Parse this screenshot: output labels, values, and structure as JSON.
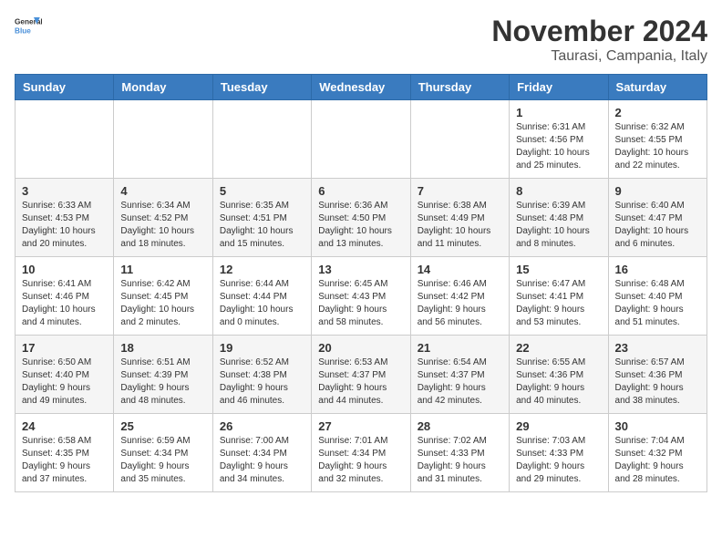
{
  "header": {
    "logo_general": "General",
    "logo_blue": "Blue",
    "title": "November 2024",
    "location": "Taurasi, Campania, Italy"
  },
  "weekdays": [
    "Sunday",
    "Monday",
    "Tuesday",
    "Wednesday",
    "Thursday",
    "Friday",
    "Saturday"
  ],
  "weeks": [
    [
      {
        "day": "",
        "info": ""
      },
      {
        "day": "",
        "info": ""
      },
      {
        "day": "",
        "info": ""
      },
      {
        "day": "",
        "info": ""
      },
      {
        "day": "",
        "info": ""
      },
      {
        "day": "1",
        "info": "Sunrise: 6:31 AM\nSunset: 4:56 PM\nDaylight: 10 hours and 25 minutes."
      },
      {
        "day": "2",
        "info": "Sunrise: 6:32 AM\nSunset: 4:55 PM\nDaylight: 10 hours and 22 minutes."
      }
    ],
    [
      {
        "day": "3",
        "info": "Sunrise: 6:33 AM\nSunset: 4:53 PM\nDaylight: 10 hours and 20 minutes."
      },
      {
        "day": "4",
        "info": "Sunrise: 6:34 AM\nSunset: 4:52 PM\nDaylight: 10 hours and 18 minutes."
      },
      {
        "day": "5",
        "info": "Sunrise: 6:35 AM\nSunset: 4:51 PM\nDaylight: 10 hours and 15 minutes."
      },
      {
        "day": "6",
        "info": "Sunrise: 6:36 AM\nSunset: 4:50 PM\nDaylight: 10 hours and 13 minutes."
      },
      {
        "day": "7",
        "info": "Sunrise: 6:38 AM\nSunset: 4:49 PM\nDaylight: 10 hours and 11 minutes."
      },
      {
        "day": "8",
        "info": "Sunrise: 6:39 AM\nSunset: 4:48 PM\nDaylight: 10 hours and 8 minutes."
      },
      {
        "day": "9",
        "info": "Sunrise: 6:40 AM\nSunset: 4:47 PM\nDaylight: 10 hours and 6 minutes."
      }
    ],
    [
      {
        "day": "10",
        "info": "Sunrise: 6:41 AM\nSunset: 4:46 PM\nDaylight: 10 hours and 4 minutes."
      },
      {
        "day": "11",
        "info": "Sunrise: 6:42 AM\nSunset: 4:45 PM\nDaylight: 10 hours and 2 minutes."
      },
      {
        "day": "12",
        "info": "Sunrise: 6:44 AM\nSunset: 4:44 PM\nDaylight: 10 hours and 0 minutes."
      },
      {
        "day": "13",
        "info": "Sunrise: 6:45 AM\nSunset: 4:43 PM\nDaylight: 9 hours and 58 minutes."
      },
      {
        "day": "14",
        "info": "Sunrise: 6:46 AM\nSunset: 4:42 PM\nDaylight: 9 hours and 56 minutes."
      },
      {
        "day": "15",
        "info": "Sunrise: 6:47 AM\nSunset: 4:41 PM\nDaylight: 9 hours and 53 minutes."
      },
      {
        "day": "16",
        "info": "Sunrise: 6:48 AM\nSunset: 4:40 PM\nDaylight: 9 hours and 51 minutes."
      }
    ],
    [
      {
        "day": "17",
        "info": "Sunrise: 6:50 AM\nSunset: 4:40 PM\nDaylight: 9 hours and 49 minutes."
      },
      {
        "day": "18",
        "info": "Sunrise: 6:51 AM\nSunset: 4:39 PM\nDaylight: 9 hours and 48 minutes."
      },
      {
        "day": "19",
        "info": "Sunrise: 6:52 AM\nSunset: 4:38 PM\nDaylight: 9 hours and 46 minutes."
      },
      {
        "day": "20",
        "info": "Sunrise: 6:53 AM\nSunset: 4:37 PM\nDaylight: 9 hours and 44 minutes."
      },
      {
        "day": "21",
        "info": "Sunrise: 6:54 AM\nSunset: 4:37 PM\nDaylight: 9 hours and 42 minutes."
      },
      {
        "day": "22",
        "info": "Sunrise: 6:55 AM\nSunset: 4:36 PM\nDaylight: 9 hours and 40 minutes."
      },
      {
        "day": "23",
        "info": "Sunrise: 6:57 AM\nSunset: 4:36 PM\nDaylight: 9 hours and 38 minutes."
      }
    ],
    [
      {
        "day": "24",
        "info": "Sunrise: 6:58 AM\nSunset: 4:35 PM\nDaylight: 9 hours and 37 minutes."
      },
      {
        "day": "25",
        "info": "Sunrise: 6:59 AM\nSunset: 4:34 PM\nDaylight: 9 hours and 35 minutes."
      },
      {
        "day": "26",
        "info": "Sunrise: 7:00 AM\nSunset: 4:34 PM\nDaylight: 9 hours and 34 minutes."
      },
      {
        "day": "27",
        "info": "Sunrise: 7:01 AM\nSunset: 4:34 PM\nDaylight: 9 hours and 32 minutes."
      },
      {
        "day": "28",
        "info": "Sunrise: 7:02 AM\nSunset: 4:33 PM\nDaylight: 9 hours and 31 minutes."
      },
      {
        "day": "29",
        "info": "Sunrise: 7:03 AM\nSunset: 4:33 PM\nDaylight: 9 hours and 29 minutes."
      },
      {
        "day": "30",
        "info": "Sunrise: 7:04 AM\nSunset: 4:32 PM\nDaylight: 9 hours and 28 minutes."
      }
    ]
  ]
}
